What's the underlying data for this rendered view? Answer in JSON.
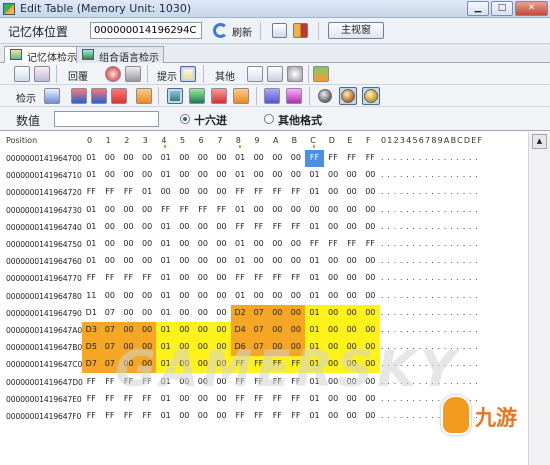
{
  "window": {
    "title": "Edit Table (Memory Unit: 1030)"
  },
  "addr_bar": {
    "label": "记忆体位置",
    "address": "000000014196294C",
    "refresh_label": "刷新",
    "main_view_label": "主视窗"
  },
  "tabs": [
    {
      "label": "记忆体检示",
      "active": true
    },
    {
      "label": "组合语言检示",
      "active": false
    }
  ],
  "toolbar1": {
    "reply_label": "回覆",
    "hint_label": "提示",
    "other_label": "其他"
  },
  "toolbar2": {
    "check_label": "检示"
  },
  "value_row": {
    "label": "数值",
    "value": "",
    "hex_label": "十六进",
    "other_format_label": "其他格式",
    "selected": "hex"
  },
  "grid": {
    "position_header": "Position",
    "hex_headers": [
      "0",
      "1",
      "2",
      "3",
      "4",
      "5",
      "6",
      "7",
      "8",
      "9",
      "A",
      "B",
      "C",
      "D",
      "E",
      "F"
    ],
    "ascii_header": "0123456789ABCDEF",
    "rows": [
      {
        "addr": "0000000141964700",
        "bytes": [
          "01",
          "00",
          "00",
          "00",
          "01",
          "00",
          "00",
          "00",
          "01",
          "00",
          "00",
          "00",
          "FF",
          "FF",
          "FF",
          "FF"
        ],
        "ascii": ". . . . . . . . . . . . . . . ."
      },
      {
        "addr": "0000000141964710",
        "bytes": [
          "01",
          "00",
          "00",
          "00",
          "01",
          "00",
          "00",
          "00",
          "01",
          "00",
          "00",
          "00",
          "01",
          "00",
          "00",
          "00"
        ],
        "ascii": ". . . . . . . . . . . . . . . ."
      },
      {
        "addr": "0000000141964720",
        "bytes": [
          "FF",
          "FF",
          "FF",
          "01",
          "00",
          "00",
          "00",
          "00",
          "FF",
          "FF",
          "FF",
          "FF",
          "01",
          "00",
          "00",
          "00"
        ],
        "ascii": ". . . . . . . . . . . . . . . ."
      },
      {
        "addr": "0000000141964730",
        "bytes": [
          "01",
          "00",
          "00",
          "00",
          "FF",
          "FF",
          "FF",
          "FF",
          "01",
          "00",
          "00",
          "00",
          "00",
          "00",
          "00",
          "00"
        ],
        "ascii": ". . . . . . . . . . . . . . . ."
      },
      {
        "addr": "0000000141964740",
        "bytes": [
          "01",
          "00",
          "00",
          "00",
          "01",
          "00",
          "00",
          "00",
          "FF",
          "FF",
          "FF",
          "FF",
          "01",
          "00",
          "00",
          "00"
        ],
        "ascii": ". . . . . . . . . . . . . . . ."
      },
      {
        "addr": "0000000141964750",
        "bytes": [
          "01",
          "00",
          "00",
          "00",
          "01",
          "00",
          "00",
          "00",
          "01",
          "00",
          "00",
          "00",
          "FF",
          "FF",
          "FF",
          "FF"
        ],
        "ascii": ". . . . . . . . . . . . . . . ."
      },
      {
        "addr": "0000000141964760",
        "bytes": [
          "01",
          "00",
          "00",
          "00",
          "01",
          "00",
          "00",
          "00",
          "01",
          "00",
          "00",
          "00",
          "01",
          "00",
          "00",
          "00"
        ],
        "ascii": ". . . . . . . . . . . . . . . ."
      },
      {
        "addr": "0000000141964770",
        "bytes": [
          "FF",
          "FF",
          "FF",
          "FF",
          "01",
          "00",
          "00",
          "00",
          "FF",
          "FF",
          "FF",
          "FF",
          "01",
          "00",
          "00",
          "00"
        ],
        "ascii": ". . . . . . . . . . . . . . . ."
      },
      {
        "addr": "0000000141964780",
        "bytes": [
          "11",
          "00",
          "00",
          "00",
          "01",
          "00",
          "00",
          "00",
          "01",
          "00",
          "00",
          "00",
          "01",
          "00",
          "00",
          "00"
        ],
        "ascii": ". . . . . . . . . . . . . . . ."
      },
      {
        "addr": "0000000141964790",
        "bytes": [
          "D1",
          "07",
          "00",
          "00",
          "01",
          "00",
          "00",
          "00",
          "D2",
          "07",
          "00",
          "00",
          "01",
          "00",
          "00",
          "00"
        ],
        "ascii": ". . . . . . . . . . . . . . . ."
      },
      {
        "addr": "00000001419647A0",
        "bytes": [
          "D3",
          "07",
          "00",
          "00",
          "01",
          "00",
          "00",
          "00",
          "D4",
          "07",
          "00",
          "00",
          "01",
          "00",
          "00",
          "00"
        ],
        "ascii": ". . . . . . . . . . . . . . . ."
      },
      {
        "addr": "00000001419647B0",
        "bytes": [
          "D5",
          "07",
          "00",
          "00",
          "01",
          "00",
          "00",
          "00",
          "D6",
          "07",
          "00",
          "00",
          "01",
          "00",
          "00",
          "00"
        ],
        "ascii": ". . . . . . . . . . . . . . . ."
      },
      {
        "addr": "00000001419647C0",
        "bytes": [
          "D7",
          "07",
          "00",
          "00",
          "01",
          "00",
          "00",
          "00",
          "FF",
          "FF",
          "FF",
          "FF",
          "01",
          "00",
          "00",
          "00"
        ],
        "ascii": ". . . . . . . . . . . . . . . ."
      },
      {
        "addr": "00000001419647D0",
        "bytes": [
          "FF",
          "FF",
          "FF",
          "FF",
          "01",
          "00",
          "00",
          "00",
          "FF",
          "FF",
          "FF",
          "FF",
          "01",
          "00",
          "00",
          "00"
        ],
        "ascii": ". . . . . . . . . . . . . . . ."
      },
      {
        "addr": "00000001419647E0",
        "bytes": [
          "FF",
          "FF",
          "FF",
          "FF",
          "01",
          "00",
          "00",
          "00",
          "FF",
          "FF",
          "FF",
          "FF",
          "01",
          "00",
          "00",
          "00"
        ],
        "ascii": ". . . . . . . . . . . . . . . ."
      },
      {
        "addr": "00000001419647F0",
        "bytes": [
          "FF",
          "FF",
          "FF",
          "FF",
          "01",
          "00",
          "00",
          "00",
          "FF",
          "FF",
          "FF",
          "FF",
          "01",
          "00",
          "00",
          "00"
        ],
        "ascii": ". . . . . . . . . . . . . . . ."
      }
    ],
    "selected_cell": {
      "row": 0,
      "col": 12
    },
    "highlights": [
      {
        "row": 9,
        "cols": [
          0,
          1,
          2,
          3
        ],
        "color": "#ffffff"
      },
      {
        "row": 9,
        "cols": [
          4,
          5,
          6,
          7
        ],
        "color": "#ffffff"
      },
      {
        "row": 9,
        "cols": [
          8,
          9,
          10,
          11
        ],
        "color": "#f4a624"
      },
      {
        "row": 9,
        "cols": [
          12,
          13,
          14,
          15
        ],
        "color": "#fff21a"
      },
      {
        "row": 10,
        "cols": [
          0,
          1,
          2,
          3
        ],
        "color": "#f4a624"
      },
      {
        "row": 10,
        "cols": [
          4,
          5,
          6,
          7
        ],
        "color": "#fff21a"
      },
      {
        "row": 10,
        "cols": [
          8,
          9,
          10,
          11
        ],
        "color": "#f4a624"
      },
      {
        "row": 10,
        "cols": [
          12,
          13,
          14,
          15
        ],
        "color": "#fff21a"
      },
      {
        "row": 11,
        "cols": [
          0,
          1,
          2,
          3
        ],
        "color": "#f4a624"
      },
      {
        "row": 11,
        "cols": [
          4,
          5,
          6,
          7
        ],
        "color": "#fff21a"
      },
      {
        "row": 11,
        "cols": [
          8,
          9,
          10,
          11
        ],
        "color": "#f4a624"
      },
      {
        "row": 11,
        "cols": [
          12,
          13,
          14,
          15
        ],
        "color": "#fff21a"
      },
      {
        "row": 12,
        "cols": [
          0,
          1,
          2,
          3
        ],
        "color": "#f4a624"
      },
      {
        "row": 12,
        "cols": [
          4,
          5,
          6,
          7
        ],
        "color": "#fff21a"
      },
      {
        "row": 12,
        "cols": [
          8,
          9,
          10,
          11
        ],
        "color": "#fff21a"
      },
      {
        "row": 12,
        "cols": [
          12,
          13,
          14,
          15
        ],
        "color": "#fff21a"
      }
    ]
  },
  "watermark": {
    "text": "GAMERSKY"
  },
  "logo": {
    "text": "九游"
  },
  "colors": {
    "selected_cell": "#4a90e2",
    "orange": "#f4a624",
    "yellow": "#fff21a"
  }
}
